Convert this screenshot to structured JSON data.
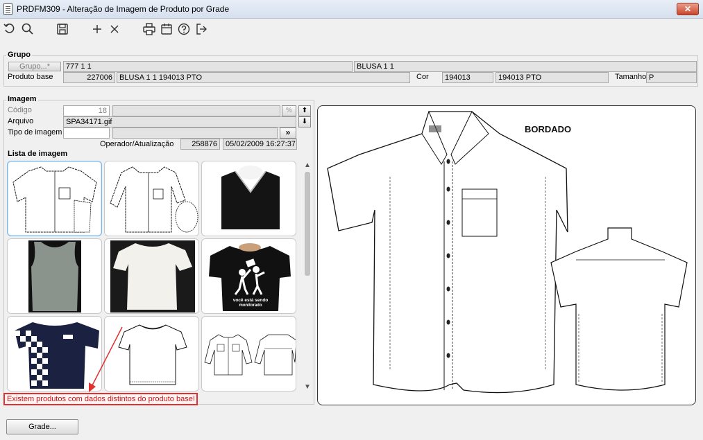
{
  "window": {
    "title": "PRDFM309 - Alteração de Imagem de Produto por Grade",
    "close_label": "✕"
  },
  "toolbar": {
    "items": [
      "undo-icon",
      "search-icon",
      "save-icon",
      "add-icon",
      "delete-icon",
      "print-icon",
      "calendar-icon",
      "help-icon",
      "exit-icon"
    ]
  },
  "grupo": {
    "legend": "Grupo",
    "grupo_button": "Grupo...*",
    "grupo_code": "777 1 1",
    "grupo_desc": "BLUSA 1 1",
    "produto_base_label": "Produto base",
    "produto_base_code": "227006",
    "produto_base_desc": "BLUSA 1 1 194013 PTO",
    "cor_label": "Cor",
    "cor_code": "194013",
    "cor_desc": "194013 PTO",
    "tamanho_label": "Tamanho",
    "tamanho_value": "P"
  },
  "imagem": {
    "legend": "Imagem",
    "codigo_label": "Código",
    "codigo_value": "18",
    "arquivo_label": "Arquivo",
    "arquivo_value": "SPA34171.gif",
    "tipo_label": "Tipo de imagem",
    "tipo_value": "",
    "operador_label": "Operador/Atualização",
    "operador_value": "258876",
    "atualizacao_value": "05/02/2009 16:27:37",
    "btn_up": "⬆",
    "btn_down": "⬇",
    "btn_more": "»",
    "btn_clear": "%"
  },
  "lista": {
    "legend": "Lista de imagem",
    "thumbs": [
      "shirt-sketch-front",
      "shirt-sketch-long",
      "black-vneck-sweater",
      "gray-tank-top",
      "white-tshirt",
      "black-tshirt-print",
      "navy-checkered-tshirt",
      "tshirt-sketch",
      "long-sleeve-sketch"
    ],
    "print_text_1": "você está sendo",
    "print_text_2": "monitorado"
  },
  "warning": {
    "text": "Existem produtos com dados distintos do produto base!"
  },
  "preview": {
    "label": "BORDADO"
  },
  "bottom": {
    "grade_button": "Grade..."
  }
}
